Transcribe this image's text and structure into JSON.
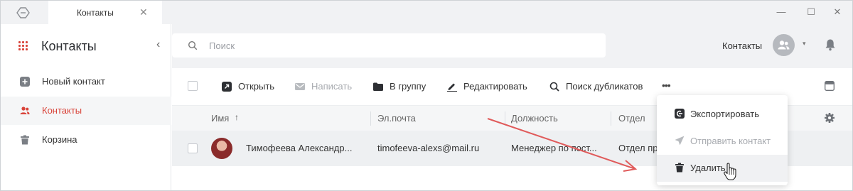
{
  "window": {
    "tab_label": "Контакты",
    "tab_close": "✕",
    "minimize": "—",
    "maximize": "☐",
    "close": "✕"
  },
  "sidebar": {
    "title": "Контакты",
    "collapse": "‹",
    "items": [
      {
        "label": "Новый контакт",
        "icon": "plus-square-icon"
      },
      {
        "label": "Контакты",
        "icon": "users-icon",
        "active": true
      },
      {
        "label": "Корзина",
        "icon": "trash-icon"
      }
    ]
  },
  "topbar": {
    "search_placeholder": "Поиск",
    "user_label": "Контакты",
    "avatar_icon": "group-avatar-icon",
    "caret": "▾",
    "bell_icon": "bell-icon"
  },
  "toolbar": {
    "open": "Открыть",
    "write": "Написать",
    "to_group": "В группу",
    "edit": "Редактировать",
    "find_duplicates": "Поиск дубликатов",
    "more": "•••"
  },
  "table": {
    "columns": [
      "Имя",
      "Эл.почта",
      "Должность",
      "Отдел"
    ],
    "sort_arrow": "↑",
    "rows": [
      {
        "name": "Тимофеева Александр...",
        "email": "timofeeva-alexs@mail.ru",
        "position": "Менеджер по пост...",
        "department": "Отдел пр"
      }
    ]
  },
  "more_menu": {
    "items": [
      {
        "label": "Экспортировать",
        "icon": "export-icon",
        "disabled": false
      },
      {
        "label": "Отправить контакт",
        "icon": "send-icon",
        "disabled": true
      },
      {
        "label": "Удалить",
        "icon": "trash-icon",
        "disabled": false,
        "hovered": true
      }
    ]
  },
  "colors": {
    "accent": "#d9443a",
    "annotation_arrow": "#e05a5a",
    "background": "#f1f2f4"
  }
}
